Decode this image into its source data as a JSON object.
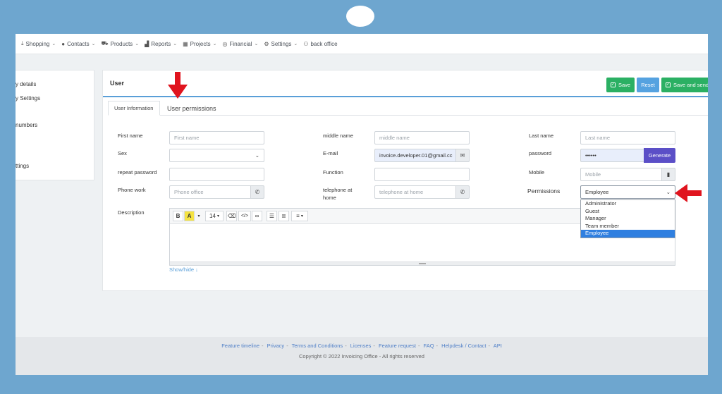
{
  "nav": [
    {
      "label": "Shopping",
      "icon": "download-icon"
    },
    {
      "label": "Contacts",
      "icon": "person-icon"
    },
    {
      "label": "Products",
      "icon": "cart-icon"
    },
    {
      "label": "Reports",
      "icon": "chart-icon"
    },
    {
      "label": "Projects",
      "icon": "grid-icon"
    },
    {
      "label": "Financial",
      "icon": "coins-icon"
    },
    {
      "label": "Settings",
      "icon": "gear-icon"
    },
    {
      "label": "back office",
      "icon": "users-icon"
    }
  ],
  "sidebar": {
    "items": [
      "y details",
      "y Settings",
      "numbers",
      "ttings"
    ]
  },
  "card": {
    "title": "User",
    "save_label": "Save",
    "reset_label": "Reset",
    "send_label": "Save and send"
  },
  "tabs": {
    "info": "User Information",
    "permissions": "User permissions"
  },
  "form": {
    "first_name_label": "First name",
    "first_name_ph": "First name",
    "middle_name_label": "middle name",
    "middle_name_ph": "middle name",
    "last_name_label": "Last name",
    "last_name_ph": "Last name",
    "sex_label": "Sex",
    "email_label": "E-mail",
    "email_value": "invoice.developer.01@gmail.cc",
    "password_label": "password",
    "password_value": "••••••",
    "generate_label": "Generate",
    "repeat_password_label": "repeat password",
    "function_label": "Function",
    "mobile_label": "Mobile",
    "mobile_ph": "Mobile",
    "phone_work_label": "Phone work",
    "phone_office_ph": "Phone office",
    "telephone_home_label_1": "telephone at",
    "telephone_home_label_2": "home",
    "telephone_home_ph": "telephone at home",
    "permissions_label": "Permissions",
    "permissions_value": "Employee",
    "permissions_options": [
      "Administrator",
      "Guest",
      "Manager",
      "Team member",
      "Employee"
    ],
    "description_label": "Description",
    "font_size": "14",
    "show_hide": "Show/hide"
  },
  "footer": {
    "links": [
      "Feature timeline",
      "Privacy",
      "Terms and Conditions",
      "Licenses",
      "Feature request",
      "FAQ",
      "Helpdesk / Contact",
      "API"
    ],
    "copyright": "Copyright © 2022 Invoicing Office - All rights reserved"
  },
  "colors": {
    "frame": "#6ea6cf",
    "save_green": "#2bb063",
    "reset_blue": "#55a2e0",
    "generate_purple": "#5b4fc7",
    "selected_option": "#2f7fe0",
    "annotation_red": "#e0141e"
  }
}
